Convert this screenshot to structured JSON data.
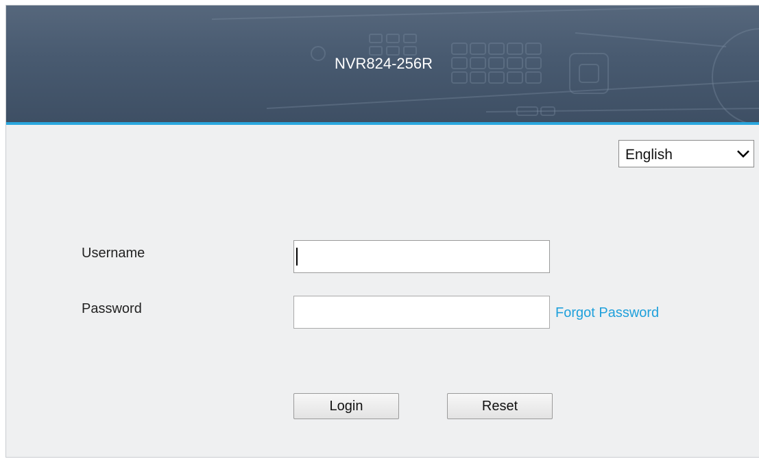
{
  "header": {
    "device_title": "NVR824-256R",
    "accent_color": "#2aa7de",
    "background_color": "#485a70"
  },
  "language": {
    "selected": "English",
    "icon": "chevron-down-icon"
  },
  "form": {
    "username_label": "Username",
    "username_value": "",
    "password_label": "Password",
    "password_value": "",
    "forgot_password_label": "Forgot Password",
    "link_color": "#1fa0db"
  },
  "buttons": {
    "login_label": "Login",
    "reset_label": "Reset"
  }
}
